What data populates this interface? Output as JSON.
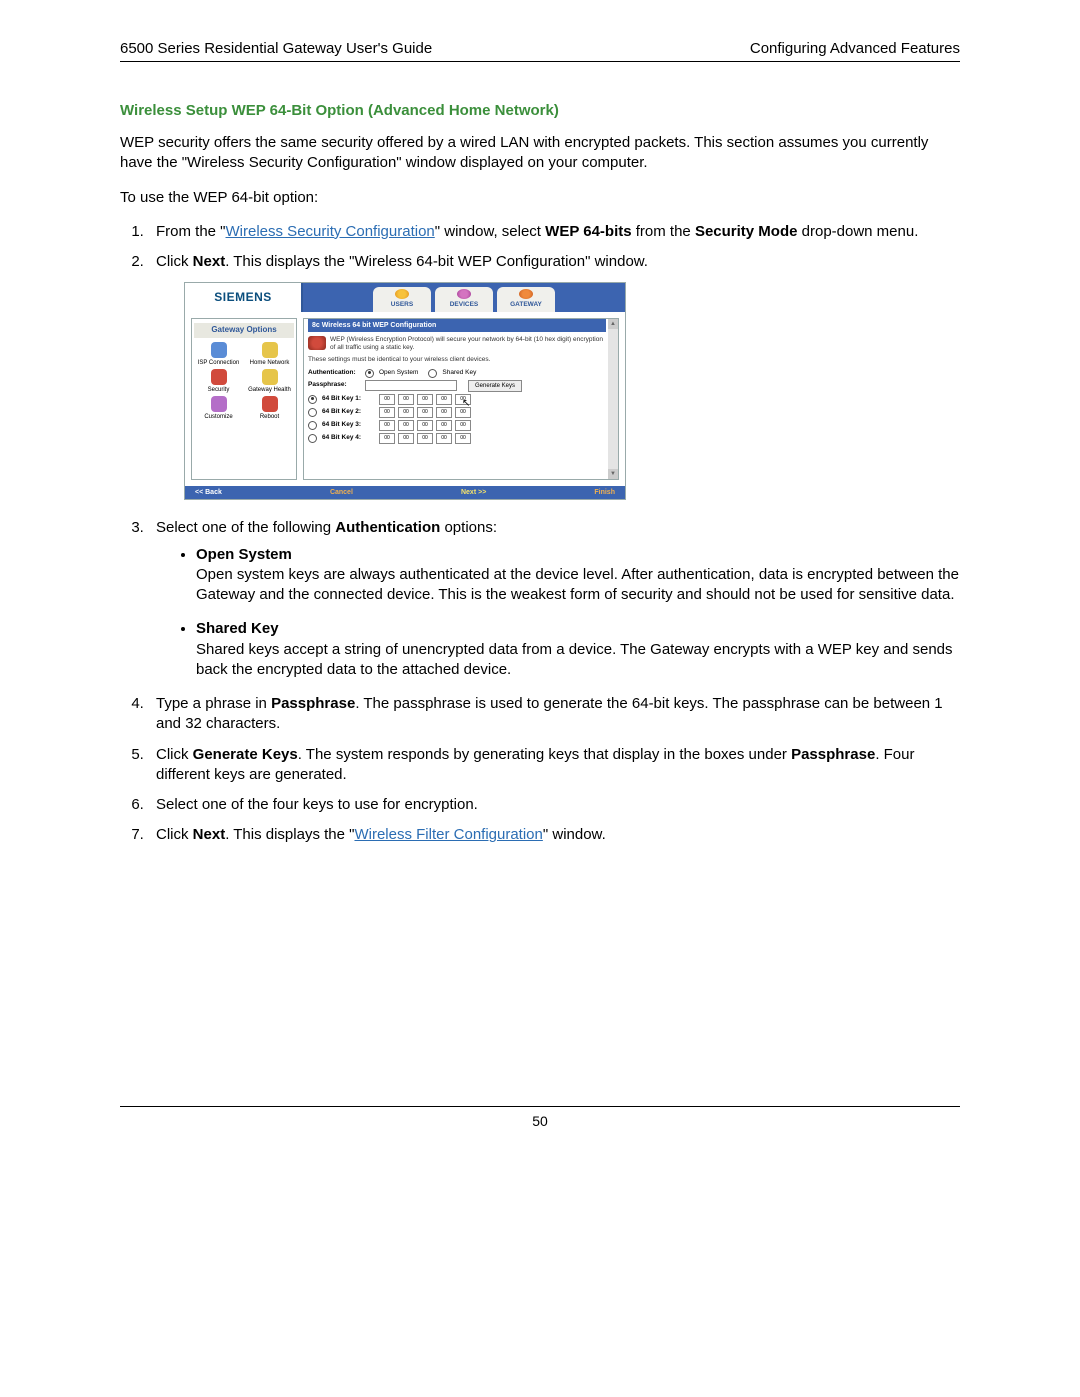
{
  "header": {
    "left": "6500 Series Residential Gateway User's Guide",
    "right": "Configuring Advanced Features"
  },
  "section_title": "Wireless Setup WEP 64-Bit Option (Advanced Home Network)",
  "intro": "WEP security offers the same security offered by a wired LAN with encrypted packets. This section assumes you currently have the \"Wireless Security Configuration\" window displayed on your computer.",
  "lead_in": "To use the WEP 64-bit option:",
  "step1": {
    "pre": "From the \"",
    "link": "Wireless Security Configuration",
    "post": "\" window, select ",
    "b1": "WEP 64-bits",
    "mid": " from the ",
    "b2": "Security Mode",
    "tail": " drop-down menu."
  },
  "step2": {
    "pre": "Click ",
    "b1": "Next",
    "post": ". This displays the \"Wireless 64-bit WEP Configuration\" window."
  },
  "step3": {
    "pre": "Select one of the following ",
    "b1": "Authentication",
    "post": " options:",
    "opt_open_title": "Open System",
    "opt_open_body": "Open system keys are always authenticated at the device level. After authentication, data is encrypted between the Gateway and the connected device. This is the weakest form of security and should not be used for sensitive data.",
    "opt_shared_title": "Shared Key",
    "opt_shared_body": "Shared keys accept a string of unencrypted data from a device. The Gateway encrypts with a WEP key and sends back the encrypted data to the attached device."
  },
  "step4": {
    "pre": "Type a phrase in ",
    "b1": "Passphrase",
    "post": ". The passphrase is used to generate the 64-bit keys. The passphrase can be between 1 and 32 characters."
  },
  "step5": {
    "pre": "Click ",
    "b1": "Generate Keys",
    "mid": ". The system responds by generating keys that display in the boxes under ",
    "b2": "Passphrase",
    "post": ". Four different keys are generated."
  },
  "step6": "Select one of the four keys to use for encryption.",
  "step7": {
    "pre": "Click ",
    "b1": "Next",
    "mid": ". This displays the \"",
    "link": "Wireless Filter Configuration",
    "post": "\" window."
  },
  "screenshot": {
    "brand": "SIEMENS",
    "tabs": {
      "users": "USERS",
      "devices": "DEVICES",
      "gateway": "GATEWAY"
    },
    "sidebar": {
      "title": "Gateway Options",
      "items": [
        {
          "label": "ISP Connection"
        },
        {
          "label": "Home Network"
        },
        {
          "label": "Security"
        },
        {
          "label": "Gateway Health"
        },
        {
          "label": "Customize"
        },
        {
          "label": "Reboot"
        }
      ]
    },
    "panel_title": "8c Wireless 64 bit WEP Configuration",
    "desc": "WEP (Wireless Encryption Protocol) will secure your network by 64-bit (10 hex digit) encryption of all traffic using a static key.",
    "note": "These settings must be identical to your wireless client devices.",
    "auth_label": "Authentication:",
    "auth_open": "Open System",
    "auth_shared": "Shared Key",
    "pass_label": "Passphrase:",
    "gen_btn": "Generate Keys",
    "keys": [
      {
        "label": "64 Bit Key 1:",
        "v": [
          "00",
          "00",
          "00",
          "00",
          "00"
        ]
      },
      {
        "label": "64 Bit Key 2:",
        "v": [
          "00",
          "00",
          "00",
          "00",
          "00"
        ]
      },
      {
        "label": "64 Bit Key 3:",
        "v": [
          "00",
          "00",
          "00",
          "00",
          "00"
        ]
      },
      {
        "label": "64 Bit Key 4:",
        "v": [
          "00",
          "00",
          "00",
          "00",
          "00"
        ]
      }
    ],
    "buttons": {
      "back": "<< Back",
      "cancel": "Cancel",
      "next": "Next >>",
      "finish": "Finish"
    }
  },
  "page_number": "50"
}
